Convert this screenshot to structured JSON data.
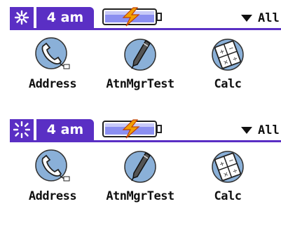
{
  "panels": [
    {
      "status": {
        "attn_icon": "starburst-icon",
        "time": "4 am",
        "battery_icon": "battery-charging-icon",
        "category": "All"
      },
      "apps": [
        {
          "label": "Address",
          "icon": "phone-handset-icon"
        },
        {
          "label": "AtnMgrTest",
          "icon": "pen-icon"
        },
        {
          "label": "Calc",
          "icon": "calculator-icon"
        }
      ]
    },
    {
      "status": {
        "attn_icon": "blinking-starburst-icon",
        "time": "4 am",
        "battery_icon": "battery-charging-icon",
        "category": "All"
      },
      "apps": [
        {
          "label": "Address",
          "icon": "phone-handset-icon"
        },
        {
          "label": "AtnMgrTest",
          "icon": "pen-icon"
        },
        {
          "label": "Calc",
          "icon": "calculator-icon"
        }
      ]
    }
  ],
  "colors": {
    "accent": "#5a2fc4",
    "icon_fill": "#8ab0d8",
    "battery_fill": "#8b8ff0",
    "lightning": "#f2a000"
  }
}
